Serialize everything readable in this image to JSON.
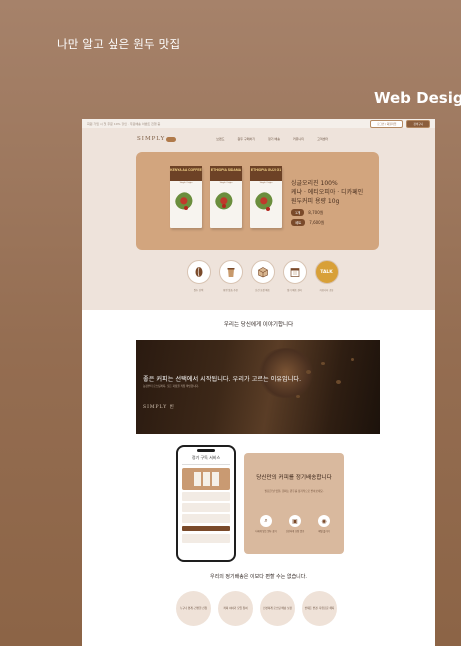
{
  "outer": {
    "title": "나만 알고 싶은 원두 맛집",
    "tag": "Web Design"
  },
  "topbar": {
    "notice": "회원 가입 시 첫 주문 10% 할인 · 무료배송 이벤트 진행 중",
    "login": "로그인 / 회원가입",
    "cart": "장바구니"
  },
  "nav": {
    "logo_left": "SIMPLY",
    "logo_right": "빈",
    "menu": [
      "브랜드",
      "원두 구매하기",
      "정기 배송",
      "커뮤니티",
      "고객센터"
    ]
  },
  "banner": {
    "bags": [
      {
        "name": "KENYA AA COFFEE",
        "sub": "Single Origin"
      },
      {
        "name": "ETHIOPIA SIDAMA",
        "sub": "Single Origin"
      },
      {
        "name": "ETHIOPIA GUJI G1",
        "sub": "Single Origin"
      }
    ],
    "line1": "싱글오리진 100%",
    "line2": "케냐 · 에티오피아 · 디카페인",
    "line3": "원두커피 용량 10g",
    "price_label_1": "1개",
    "price_value_1": "8,700원",
    "price_label_2": "세트",
    "price_value_2": "7,600원"
  },
  "features": [
    {
      "icon": "coffee-bean-icon",
      "label": "원두 선택"
    },
    {
      "icon": "cup-icon",
      "label": "취향 맞춤 추천"
    },
    {
      "icon": "box-icon",
      "label": "신선 포장 배송"
    },
    {
      "icon": "calendar-icon",
      "label": "정기 배송 관리"
    },
    {
      "icon": "talk-icon",
      "label": "커뮤니티 공유",
      "badge": "TALK"
    }
  ],
  "story": {
    "title": "우리는 당신에게 이야기합니다",
    "headline": "좋은 커피는 선택에서 시작됩니다. 우리가 고르는 이유입니다.",
    "sub": "농장부터 로스팅까지, 모든 과정을 직접 확인합니다.",
    "logo": "SIMPLY 빈"
  },
  "phone": {
    "title": "정기 구독 서비스"
  },
  "subscription": {
    "title": "당신만의 커피를 정기배송합니다",
    "desc": "필요한 날 맞춰, 원하는 원두를 정기적으로 받아보세요.",
    "icons": [
      {
        "icon": "search-icon",
        "label": "나에게 맞는 원두 찾기",
        "glyph": "⌕"
      },
      {
        "icon": "box-icon",
        "label": "신선하게 포장 발송",
        "glyph": "▣"
      },
      {
        "icon": "coffee-bean-icon",
        "label": "매일 즐기기",
        "glyph": "◉"
      }
    ]
  },
  "benefits": {
    "title": "우리의 정기배송은 이보다 편할 수는 없습니다.",
    "items": [
      "누구나 쉽게, 간편한 신청",
      "커피 이야기 모임 참여",
      "신선하게 로스팅 배송 보장",
      "언제든 변경, 자유로운 해지"
    ]
  },
  "colors": {
    "accent": "#8b5e3c",
    "banner": "#d2a57e",
    "card": "#d9b99e"
  }
}
